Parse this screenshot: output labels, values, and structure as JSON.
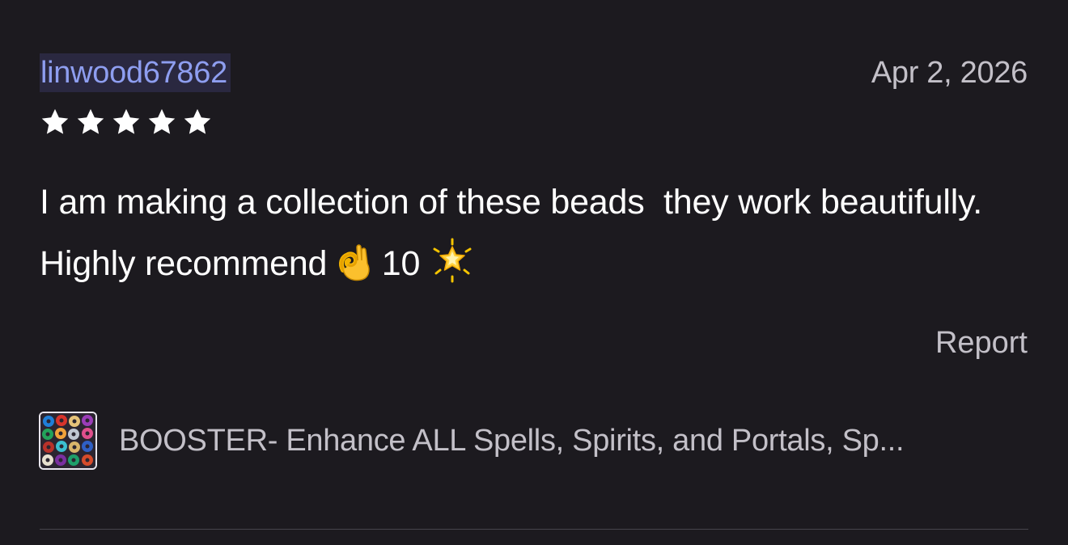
{
  "review": {
    "username": "linwood67862",
    "date": "Apr 2, 2026",
    "rating": 5,
    "rating_max": 5,
    "text_part1": "I am making a collection of these beads  they work beautifully.  Highly recommend ",
    "text_part2": " 10 ",
    "emoji_1": "ok-hand-icon",
    "emoji_2": "glowing-star-icon",
    "report_label": "Report"
  },
  "product": {
    "title": "BOOSTER- Enhance ALL Spells, Spirits, and Portals, Sp...",
    "thumbnail": "beads-thumbnail-image"
  },
  "colors": {
    "background": "#1c1a1f",
    "username": "#8e9ef0",
    "muted_text": "#c3c0c8",
    "star": "#ffffff"
  }
}
